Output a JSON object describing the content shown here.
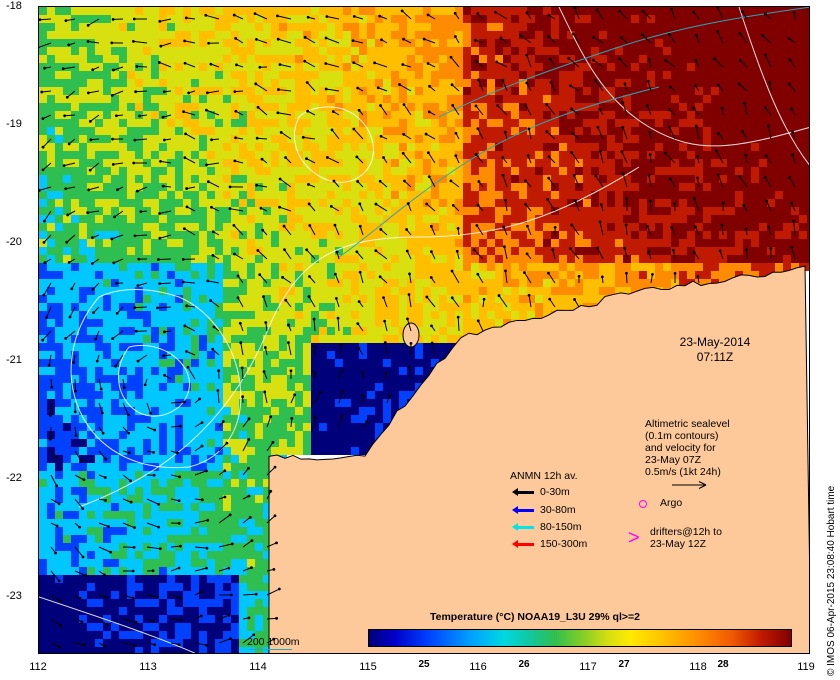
{
  "map": {
    "lon_range": [
      112,
      119
    ],
    "lat_range": [
      -23.5,
      -18
    ],
    "x_ticks": [
      "112",
      "113",
      "114",
      "115",
      "116",
      "117",
      "118",
      "119"
    ],
    "y_ticks": [
      "-18",
      "-19",
      "-20",
      "-21",
      "-22",
      "-23"
    ],
    "land_color": "#fdc99a",
    "ocean_palette": [
      "#00007a",
      "#0040ff",
      "#00c8ff",
      "#2fbf50",
      "#d8e010",
      "#ffbf00",
      "#ff8c00",
      "#c01a00",
      "#800000"
    ]
  },
  "annotations": {
    "date": "23-May-2014",
    "time": "07:11Z",
    "altimetric_lines": [
      "Altimetric sealevel",
      "(0.1m contours)",
      "and velocity for",
      "23-May 07Z",
      "0.5m/s (1kt 24h)"
    ],
    "scale_label": "200  1000m"
  },
  "legend": {
    "title": "ANMN 12h av.",
    "rows": [
      {
        "label": "0-30m",
        "color": "#000000"
      },
      {
        "label": "30-80m",
        "color": "#0000ff"
      },
      {
        "label": "80-150m",
        "color": "#00e5e5"
      },
      {
        "label": "150-300m",
        "color": "#ff0000"
      }
    ],
    "argo_label": "Argo",
    "drifter_symbol": ">",
    "drifter_lines": [
      "drifters@12h to",
      "23-May 12Z"
    ]
  },
  "colorbar": {
    "title": "Temperature (°C) NOAA19_L3U 29% ql>=2",
    "ticks": [
      "25",
      "26",
      "27",
      "28"
    ],
    "tick_fractions": [
      0.133,
      0.368,
      0.603,
      0.838
    ]
  },
  "credit": "© IMOS 06-Apr-2015 23:08:40 Hobart time"
}
